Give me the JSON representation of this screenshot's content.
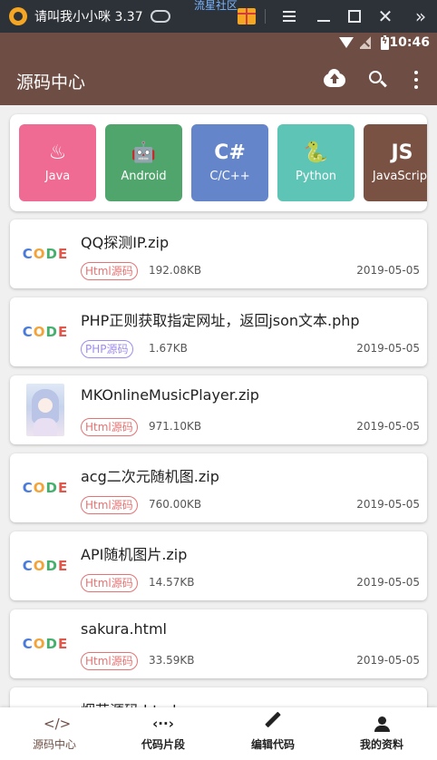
{
  "emulator": {
    "window_title": "请叫我小小咪 3.37",
    "community_label": "流星社区"
  },
  "status_bar": {
    "time": "10:46"
  },
  "toolbar": {
    "title": "源码中心",
    "icons": [
      "upload-cloud-icon",
      "search-icon",
      "more-vert-icon"
    ]
  },
  "categories": [
    {
      "label": "Java",
      "glyph": "♨",
      "color": "#f06b93"
    },
    {
      "label": "Android",
      "glyph": "🤖",
      "color": "#4fa56c"
    },
    {
      "label": "C/C++",
      "glyph": "C#",
      "color": "#6485c9"
    },
    {
      "label": "Python",
      "glyph": "🐍",
      "color": "#5ec4b6"
    },
    {
      "label": "JavaScript",
      "glyph": "JS",
      "color": "#7a5244"
    }
  ],
  "files": [
    {
      "name": "QQ探测IP.zip",
      "tag": "Html源码",
      "size": "192.08KB",
      "date": "2019-05-05",
      "thumb": "code"
    },
    {
      "name": "PHP正则获取指定网址，返回json文本.php",
      "tag": "PHP源码",
      "size": "1.67KB",
      "date": "2019-05-05",
      "thumb": "code"
    },
    {
      "name": "MKOnlineMusicPlayer.zip",
      "tag": "Html源码",
      "size": "971.10KB",
      "date": "2019-05-05",
      "thumb": "image"
    },
    {
      "name": "acg二次元随机图.zip",
      "tag": "Html源码",
      "size": "760.00KB",
      "date": "2019-05-05",
      "thumb": "code"
    },
    {
      "name": "API随机图片.zip",
      "tag": "Html源码",
      "size": "14.57KB",
      "date": "2019-05-05",
      "thumb": "code"
    },
    {
      "name": "sakura.html",
      "tag": "Html源码",
      "size": "33.59KB",
      "date": "2019-05-05",
      "thumb": "code"
    },
    {
      "name": "烟花源码.html",
      "tag": "",
      "size": "",
      "date": "",
      "thumb": "code"
    }
  ],
  "thumb_text": "CODE",
  "bottom_nav": [
    {
      "label": "源码中心",
      "icon": "code-icon",
      "active": true
    },
    {
      "label": "代码片段",
      "icon": "snippet-icon",
      "active": false
    },
    {
      "label": "编辑代码",
      "icon": "edit-icon",
      "active": false
    },
    {
      "label": "我的资料",
      "icon": "person-icon",
      "active": false
    }
  ],
  "colors": {
    "primary": "#6e4e44",
    "html_tag": "#e57373",
    "php_tag": "#9f8cf0"
  }
}
